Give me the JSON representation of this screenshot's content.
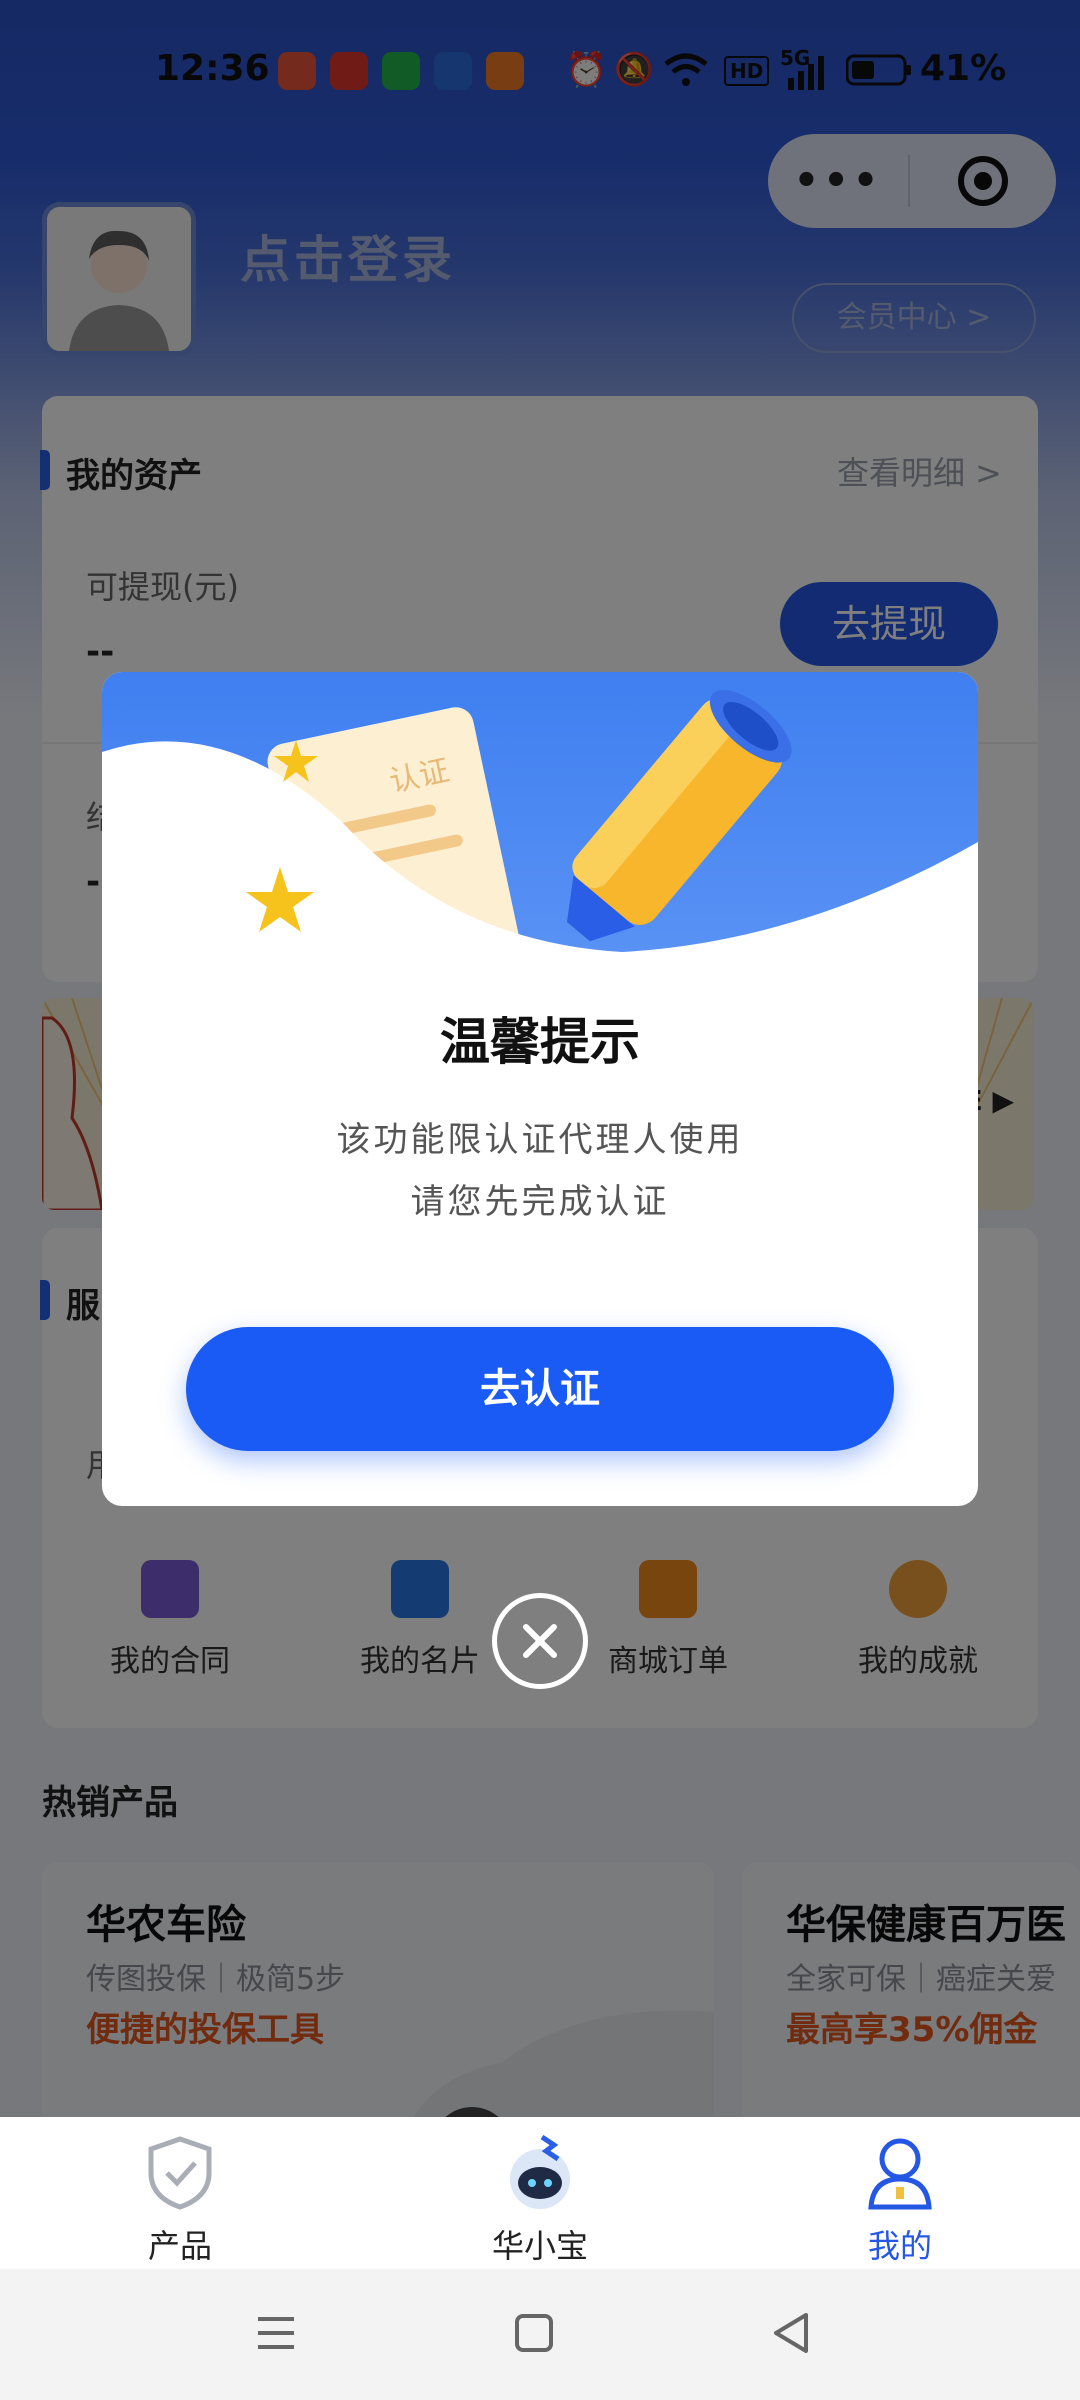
{
  "status": {
    "time": "12:36",
    "battery": "41%",
    "net": "5G",
    "notif_colors": [
      "#e8543b",
      "#e2362f",
      "#22b64c",
      "#2d6cdf",
      "#f07b24"
    ]
  },
  "capsule": {
    "more_icon": "more-icon",
    "close_icon": "target-icon"
  },
  "header": {
    "login_text": "点击登录",
    "member_center": "会员中心 >"
  },
  "assets": {
    "title": "我的资产",
    "detail_link": "查看明细 >",
    "withdrawable_label": "可提现(元)",
    "withdrawable_value": "--",
    "withdraw_button": "去提现",
    "second_label_fragment": "结",
    "second_value": "--"
  },
  "banner": {
    "fragment": "E ▶"
  },
  "services": {
    "title_fragment": "服",
    "row_fragment": "用",
    "items": [
      {
        "label": "我的合同",
        "icon": "contract-icon",
        "color": "#7a5cd6"
      },
      {
        "label": "我的名片",
        "icon": "card-icon",
        "color": "#2a78e4"
      },
      {
        "label": "商城订单",
        "icon": "order-icon",
        "color": "#f08a1c"
      },
      {
        "label": "我的成就",
        "icon": "achievement-icon",
        "color": "#f0a03a"
      }
    ]
  },
  "hot": {
    "title": "热销产品",
    "products": [
      {
        "name": "华农车险",
        "sub": "传图投保｜极简5步",
        "highlight": "便捷的投保工具"
      },
      {
        "name": "华保健康百万医",
        "sub": "全家可保｜癌症关爱",
        "highlight": "最高享35%佣金"
      }
    ]
  },
  "tabs": [
    {
      "label": "产品",
      "icon": "shield-check-icon",
      "active": false
    },
    {
      "label": "华小宝",
      "icon": "robot-icon",
      "active": false
    },
    {
      "label": "我的",
      "icon": "user-icon",
      "active": true
    }
  ],
  "dialog": {
    "illustration_text": "认证",
    "title": "温馨提示",
    "line1": "该功能限认证代理人使用",
    "line2": "请您先完成认证",
    "confirm": "去认证"
  },
  "colors": {
    "accent": "#1a5bf5",
    "active_tab": "#2557e5"
  }
}
